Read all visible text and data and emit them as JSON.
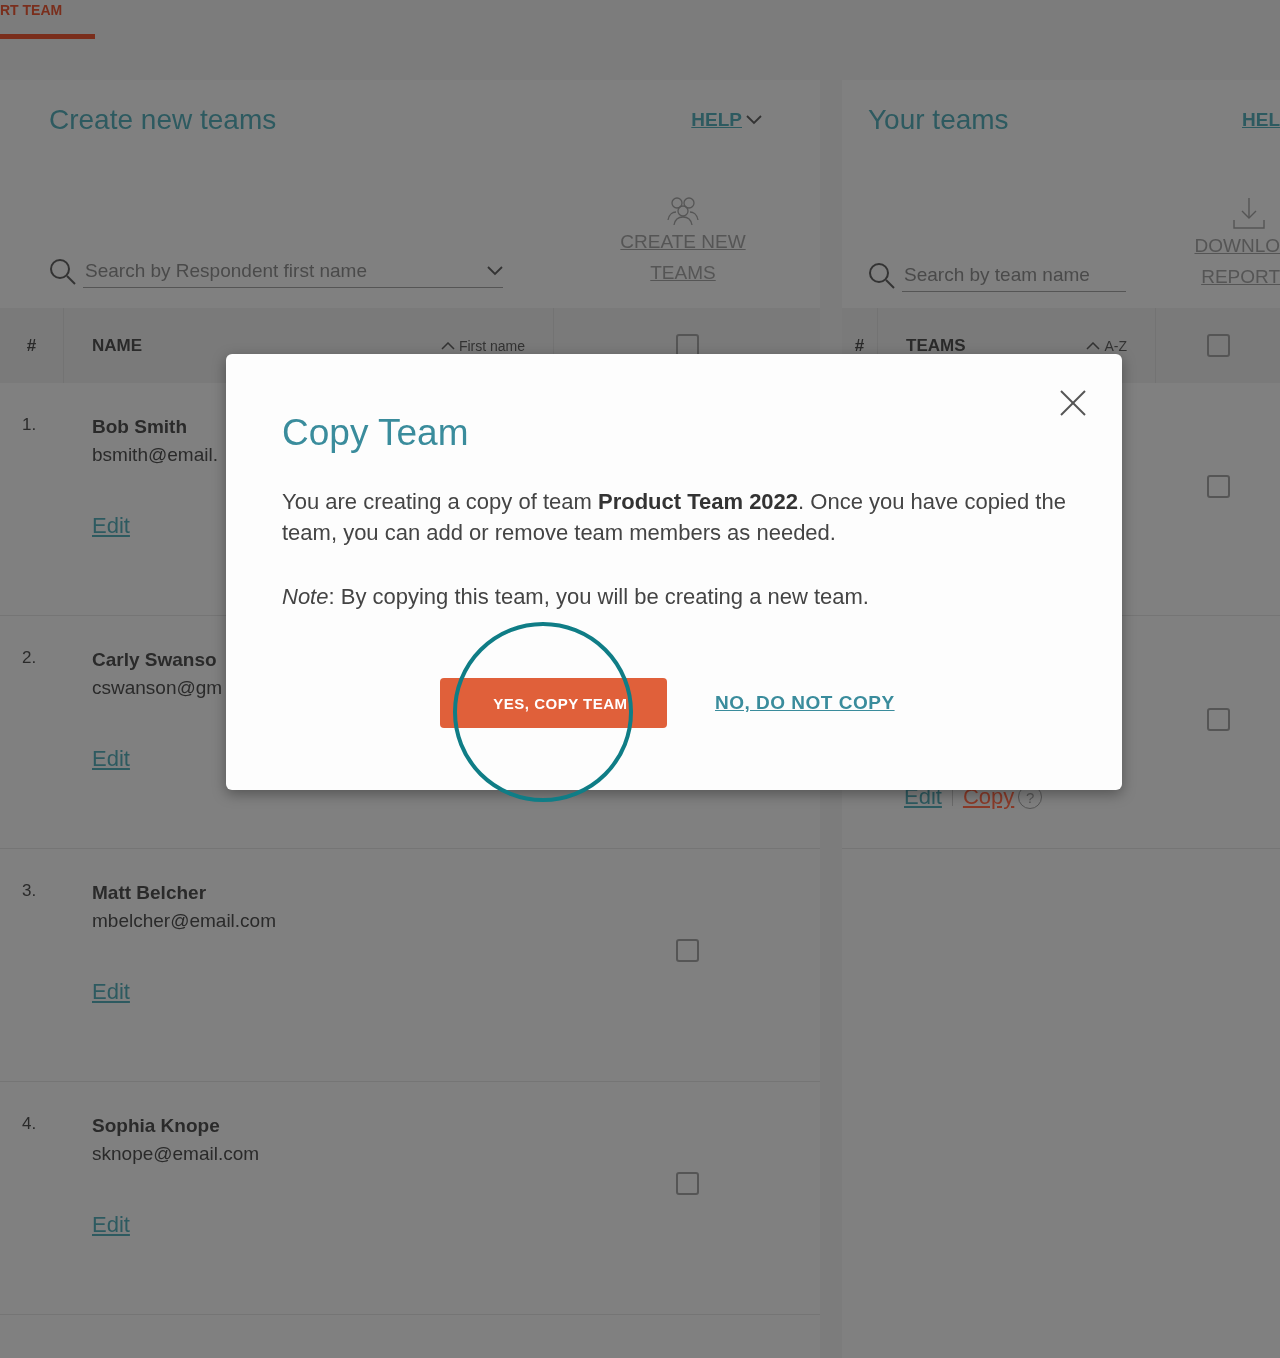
{
  "top_tab": {
    "label": "RT TEAM",
    "selected": true
  },
  "create_panel": {
    "title": "Create new teams",
    "help": "HELP",
    "search": {
      "placeholder": "Search by Respondent first name"
    },
    "action": "CREATE NEW TEAMS",
    "columns": [
      {
        "label": "#"
      },
      {
        "label": "NAME",
        "sort": "First name"
      }
    ],
    "header_checked": false,
    "rows": [
      {
        "number": "1.",
        "name": "Bob Smith",
        "email": "bsmith@email.",
        "edit": "Edit"
      },
      {
        "number": "2.",
        "name": "Carly Swanso",
        "email": "cswanson@gm",
        "edit": "Edit"
      },
      {
        "number": "3.",
        "name": "Matt Belcher",
        "email": "mbelcher@email.com",
        "edit": "Edit",
        "checked": false
      },
      {
        "number": "4.",
        "name": "Sophia Knope",
        "email": "sknope@email.com",
        "edit": "Edit",
        "checked": false
      }
    ]
  },
  "teams_panel": {
    "title": "Your teams",
    "help": "HEL",
    "search": {
      "placeholder": "Search by team name"
    },
    "action_lines": [
      "DOWNLO",
      "REPORT"
    ],
    "columns": [
      {
        "label": "#"
      },
      {
        "label": "TEAMS",
        "sort": "A-Z"
      }
    ],
    "header_checked": false,
    "rows": [
      {
        "checked": false
      },
      {
        "checked": false,
        "links": [
          {
            "label": "Edit",
            "kind": "edit"
          },
          {
            "label": "Copy",
            "kind": "copy"
          }
        ],
        "help_mark": "?"
      }
    ]
  },
  "dialog": {
    "title": "Copy Team",
    "body": "You are creating a copy of team **Product Team 2022**. Once you have copied the team, you can add or remove team members as needed.",
    "note": "*Note*: By copying this team, you will be creating a new team.",
    "confirm": "YES, COPY TEAM",
    "cancel": "NO, DO NOT COPY",
    "highlighted": true
  }
}
